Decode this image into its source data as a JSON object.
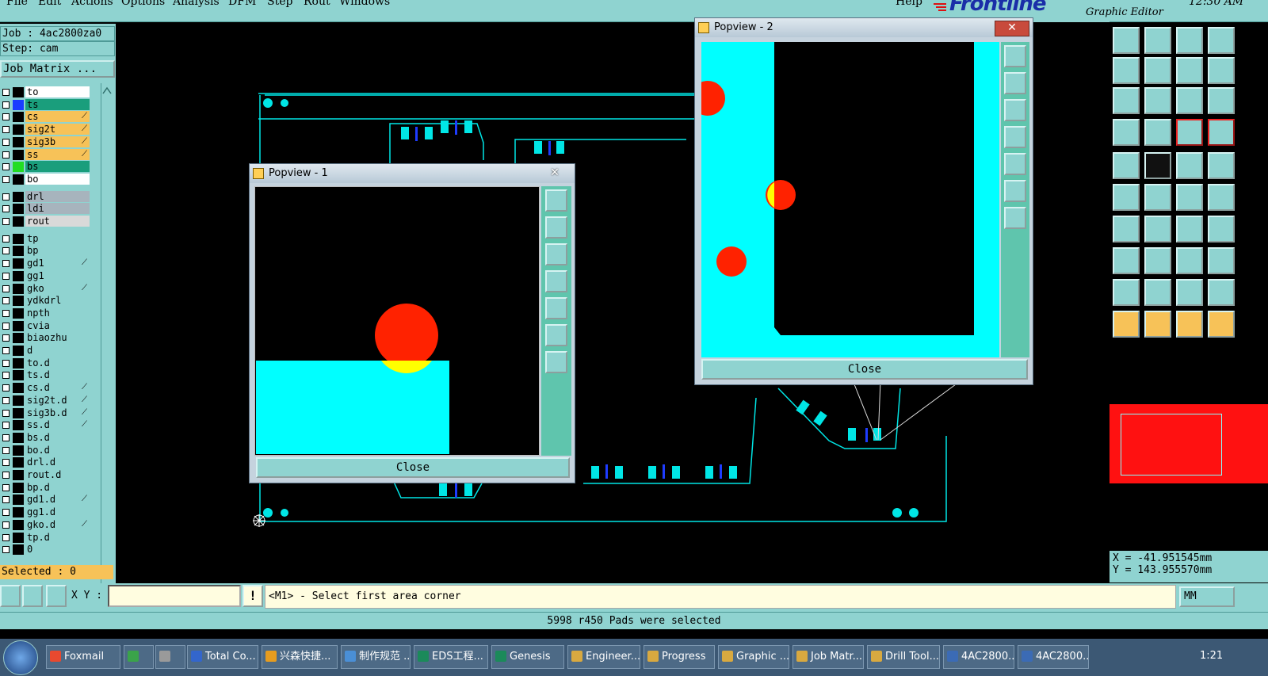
{
  "menubar": {
    "items": [
      "File",
      "Edit",
      "Actions",
      "Options",
      "Analysis",
      "DFM",
      "Step",
      "Rout",
      "Windows"
    ],
    "help": "Help",
    "logo": "Frontline",
    "editor_title": "Graphic Editor",
    "clock": "12:30 AM"
  },
  "job": {
    "job_label": "Job : 4ac2800za0",
    "step_label": "Step: cam",
    "matrix_button": "Job Matrix ..."
  },
  "layers": [
    {
      "name": "to",
      "bg": "#ffffff",
      "swatch": "#000000",
      "mark": ""
    },
    {
      "name": "ts",
      "bg": "#1a9e7c",
      "swatch": "#1a3dff",
      "mark": ""
    },
    {
      "name": "cs",
      "bg": "#f7c258",
      "swatch": "#000000",
      "mark": "⟋"
    },
    {
      "name": "sig2t",
      "bg": "#f7c258",
      "swatch": "#000000",
      "mark": "⟋"
    },
    {
      "name": "sig3b",
      "bg": "#f7c258",
      "swatch": "#000000",
      "mark": "⟋"
    },
    {
      "name": "ss",
      "bg": "#f7c258",
      "swatch": "#000000",
      "mark": "⟋"
    },
    {
      "name": "bs",
      "bg": "#1a9e7c",
      "swatch": "#22dd22",
      "mark": ""
    },
    {
      "name": "bo",
      "bg": "#ffffff",
      "swatch": "#000000",
      "mark": ""
    },
    {
      "name": "drl",
      "bg": "#a7b4bd",
      "swatch": "#000000",
      "mark": ""
    },
    {
      "name": "ldi",
      "bg": "#a7b4bd",
      "swatch": "#000000",
      "mark": ""
    },
    {
      "name": "rout",
      "bg": "#d9d9d9",
      "swatch": "#000000",
      "mark": ""
    },
    {
      "name": "tp",
      "bg": "#8fd3d0",
      "swatch": "#000000",
      "mark": ""
    },
    {
      "name": "bp",
      "bg": "#8fd3d0",
      "swatch": "#000000",
      "mark": ""
    },
    {
      "name": "gd1",
      "bg": "#8fd3d0",
      "swatch": "#000000",
      "mark": "⟋"
    },
    {
      "name": "gg1",
      "bg": "#8fd3d0",
      "swatch": "#000000",
      "mark": ""
    },
    {
      "name": "gko",
      "bg": "#8fd3d0",
      "swatch": "#000000",
      "mark": "⟋"
    },
    {
      "name": "ydkdrl",
      "bg": "#8fd3d0",
      "swatch": "#000000",
      "mark": ""
    },
    {
      "name": "npth",
      "bg": "#8fd3d0",
      "swatch": "#000000",
      "mark": ""
    },
    {
      "name": "cvia",
      "bg": "#8fd3d0",
      "swatch": "#000000",
      "mark": ""
    },
    {
      "name": "biaozhu",
      "bg": "#8fd3d0",
      "swatch": "#000000",
      "mark": ""
    },
    {
      "name": "d",
      "bg": "#8fd3d0",
      "swatch": "#000000",
      "mark": ""
    },
    {
      "name": "to.d",
      "bg": "#8fd3d0",
      "swatch": "#000000",
      "mark": ""
    },
    {
      "name": "ts.d",
      "bg": "#8fd3d0",
      "swatch": "#000000",
      "mark": ""
    },
    {
      "name": "cs.d",
      "bg": "#8fd3d0",
      "swatch": "#000000",
      "mark": "⟋"
    },
    {
      "name": "sig2t.d",
      "bg": "#8fd3d0",
      "swatch": "#000000",
      "mark": "⟋"
    },
    {
      "name": "sig3b.d",
      "bg": "#8fd3d0",
      "swatch": "#000000",
      "mark": "⟋"
    },
    {
      "name": "ss.d",
      "bg": "#8fd3d0",
      "swatch": "#000000",
      "mark": "⟋"
    },
    {
      "name": "bs.d",
      "bg": "#8fd3d0",
      "swatch": "#000000",
      "mark": ""
    },
    {
      "name": "bo.d",
      "bg": "#8fd3d0",
      "swatch": "#000000",
      "mark": ""
    },
    {
      "name": "drl.d",
      "bg": "#8fd3d0",
      "swatch": "#000000",
      "mark": ""
    },
    {
      "name": "rout.d",
      "bg": "#8fd3d0",
      "swatch": "#000000",
      "mark": ""
    },
    {
      "name": "bp.d",
      "bg": "#8fd3d0",
      "swatch": "#000000",
      "mark": ""
    },
    {
      "name": "gd1.d",
      "bg": "#8fd3d0",
      "swatch": "#000000",
      "mark": "⟋"
    },
    {
      "name": "gg1.d",
      "bg": "#8fd3d0",
      "swatch": "#000000",
      "mark": ""
    },
    {
      "name": "gko.d",
      "bg": "#8fd3d0",
      "swatch": "#000000",
      "mark": "⟋"
    },
    {
      "name": "tp.d",
      "bg": "#8fd3d0",
      "swatch": "#000000",
      "mark": ""
    },
    {
      "name": "0",
      "bg": "#8fd3d0",
      "swatch": "#000000",
      "mark": ""
    }
  ],
  "selected": "Selected : 0",
  "popview1": {
    "title": "Popview - 1",
    "close": "Close"
  },
  "popview2": {
    "title": "Popview - 2",
    "close": "Close"
  },
  "coords": {
    "x": "X = -41.951545mm",
    "y": "Y = 143.955570mm"
  },
  "command": {
    "xy_label": "X Y :",
    "xy_value": "",
    "prompt": "<M1> - Select first area corner",
    "units": "MM"
  },
  "status": "5998 r450 Pads were selected",
  "taskbar": {
    "items": [
      "Foxmail",
      "",
      "",
      "Total Co...",
      "兴森快捷...",
      "制作规范 ...",
      "EDS工程...",
      "Genesis",
      "Engineer...",
      "Progress",
      "Graphic ...",
      "Job Matr...",
      "Drill Tool...",
      "4AC2800...",
      "4AC2800..."
    ],
    "time": "1:21"
  },
  "colors": {
    "panel": "#8fd3d0",
    "pad": "#00ffff",
    "highlight": "#ff0000",
    "yellow": "#ffff00"
  }
}
